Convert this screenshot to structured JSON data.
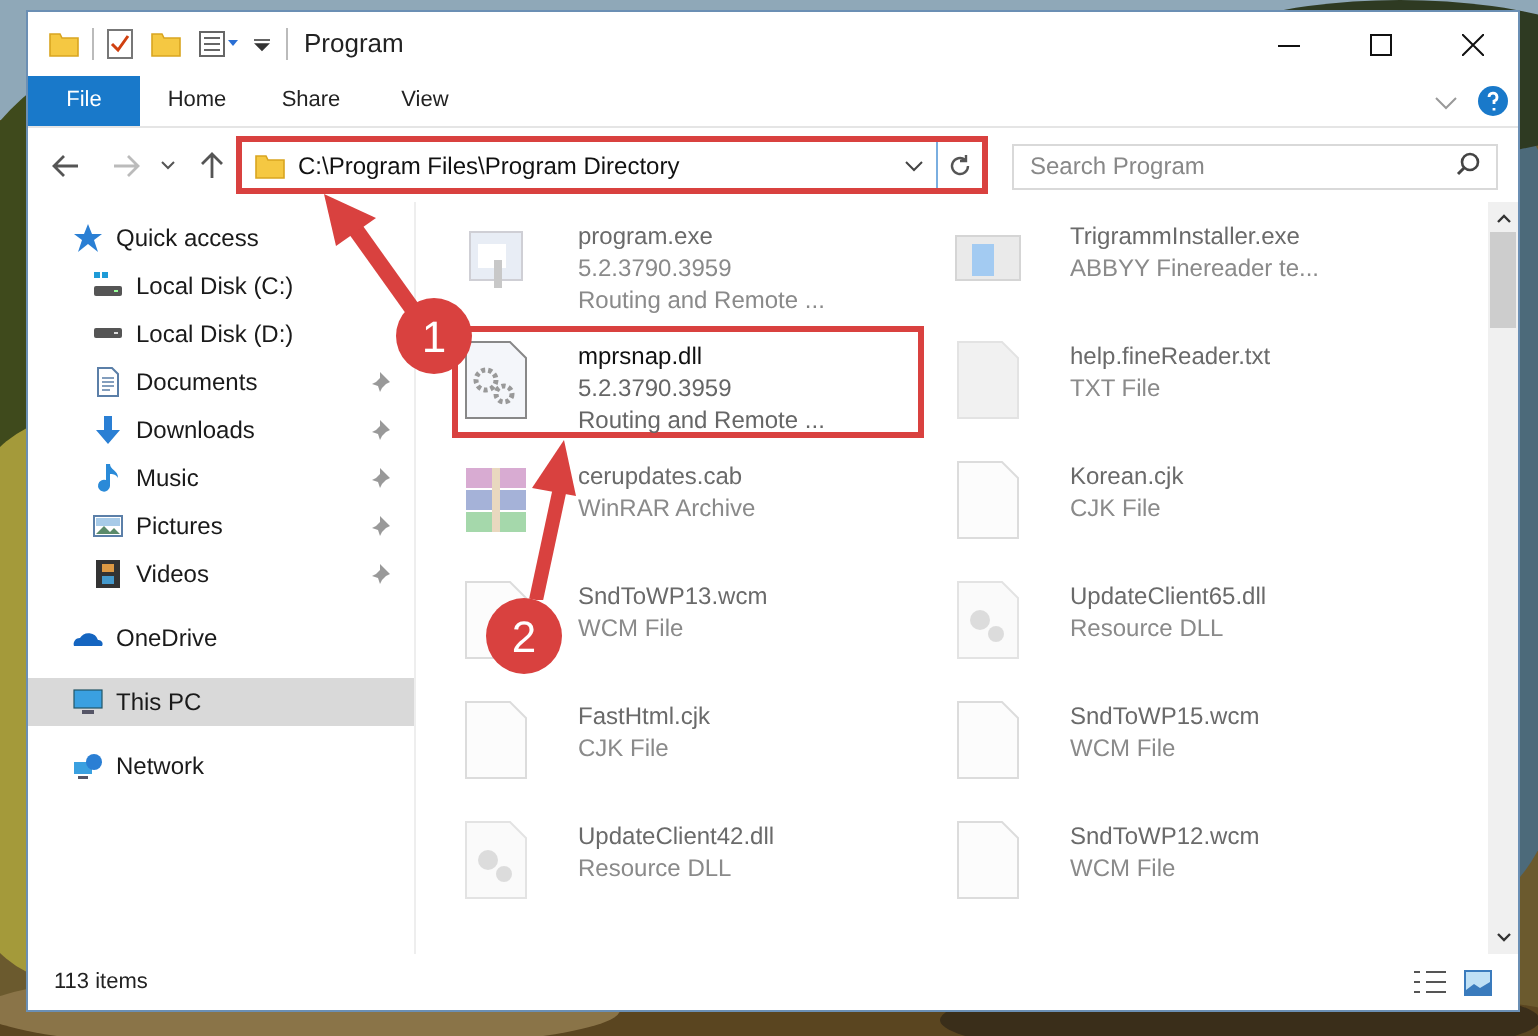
{
  "window": {
    "title": "Program"
  },
  "ribbon_tabs": [
    {
      "label": "File",
      "selected": true
    },
    {
      "label": "Home",
      "selected": false
    },
    {
      "label": "Share",
      "selected": false
    },
    {
      "label": "View",
      "selected": false
    }
  ],
  "address": {
    "path": "C:\\Program Files\\Program Directory",
    "highlighted": true
  },
  "search": {
    "placeholder": "Search Program"
  },
  "sidebar": {
    "items": [
      {
        "label": "Quick access",
        "kind": "star",
        "selected": false,
        "pinned": false,
        "children": [
          {
            "label": "Local Disk (C:)",
            "kind": "drive-c",
            "selected": false,
            "pinned": false
          },
          {
            "label": "Local Disk (D:)",
            "kind": "drive",
            "selected": false,
            "pinned": false
          },
          {
            "label": "Documents",
            "kind": "documents",
            "selected": false,
            "pinned": true
          },
          {
            "label": "Downloads",
            "kind": "downloads",
            "selected": false,
            "pinned": true
          },
          {
            "label": "Music",
            "kind": "music",
            "selected": false,
            "pinned": true
          },
          {
            "label": "Pictures",
            "kind": "pictures",
            "selected": false,
            "pinned": true
          },
          {
            "label": "Videos",
            "kind": "videos",
            "selected": false,
            "pinned": true
          }
        ]
      },
      {
        "label": "OneDrive",
        "kind": "cloud",
        "selected": false,
        "pinned": false
      },
      {
        "label": "This PC",
        "kind": "pc",
        "selected": true,
        "pinned": false
      },
      {
        "label": "Network",
        "kind": "network",
        "selected": false,
        "pinned": false
      }
    ]
  },
  "files": [
    {
      "name": "program.exe",
      "lines": [
        "5.2.3790.3959",
        "Routing and Remote ..."
      ],
      "kind": "exe",
      "highlighted": false
    },
    {
      "name": "TrigrammInstaller.exe",
      "lines": [
        "ABBYY Finereader te..."
      ],
      "kind": "installer",
      "highlighted": false
    },
    {
      "name": "mprsnap.dll",
      "lines": [
        "5.2.3790.3959",
        "Routing and Remote ..."
      ],
      "kind": "dll",
      "highlighted": true
    },
    {
      "name": "help.fineReader.txt",
      "lines": [
        "TXT File"
      ],
      "kind": "text",
      "highlighted": false
    },
    {
      "name": "cerupdates.cab",
      "lines": [
        "WinRAR Archive"
      ],
      "kind": "archive",
      "highlighted": false
    },
    {
      "name": "Korean.cjk",
      "lines": [
        "CJK File"
      ],
      "kind": "blank",
      "highlighted": false
    },
    {
      "name": "SndToWP13.wcm",
      "lines": [
        "WCM File"
      ],
      "kind": "blank",
      "highlighted": false
    },
    {
      "name": "UpdateClient65.dll",
      "lines": [
        "Resource DLL"
      ],
      "kind": "resource",
      "highlighted": false
    },
    {
      "name": "FastHtml.cjk",
      "lines": [
        "CJK File"
      ],
      "kind": "blank",
      "highlighted": false
    },
    {
      "name": "SndToWP15.wcm",
      "lines": [
        "WCM File"
      ],
      "kind": "blank",
      "highlighted": false
    },
    {
      "name": "UpdateClient42.dll",
      "lines": [
        "Resource DLL"
      ],
      "kind": "resource",
      "highlighted": false
    },
    {
      "name": "SndToWP12.wcm",
      "lines": [
        "WCM File"
      ],
      "kind": "blank",
      "highlighted": false
    }
  ],
  "status_bar": {
    "items": "113 items"
  },
  "annotations": [
    {
      "number": "1"
    },
    {
      "number": "2"
    }
  ]
}
